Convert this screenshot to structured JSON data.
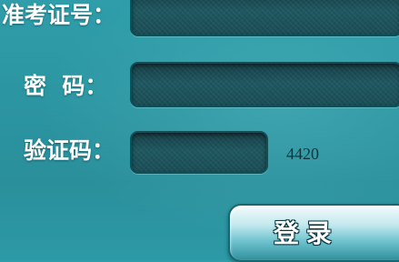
{
  "form": {
    "exam_id": {
      "label": "准考证号：",
      "value": ""
    },
    "password": {
      "label": "密  码：",
      "value": ""
    },
    "captcha": {
      "label": "验证码：",
      "value": "",
      "code": "4420"
    },
    "login_button": {
      "label": "登 录"
    }
  },
  "colors": {
    "background": "#2b96a2",
    "field_background": "#1f5760",
    "label_text": "#ffffff",
    "captcha_text": "#10333a"
  }
}
